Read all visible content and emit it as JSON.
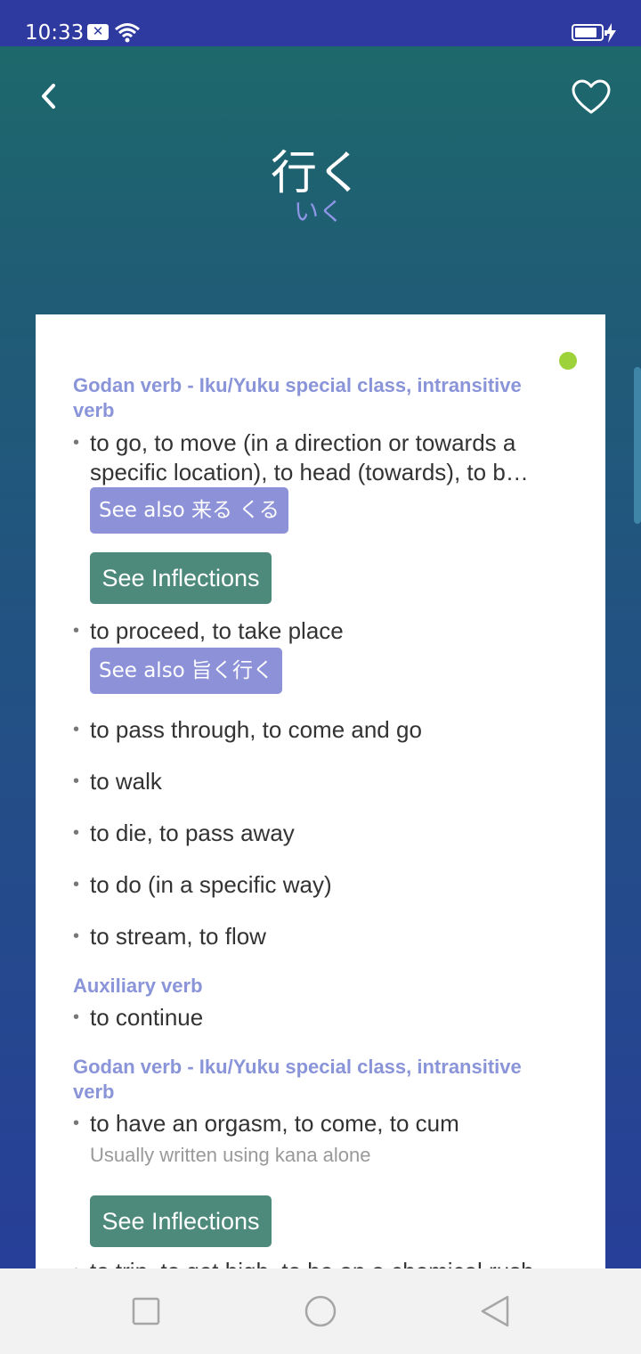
{
  "status_bar": {
    "time": "10:33",
    "icons": [
      "notification-x-icon",
      "wifi-icon",
      "battery-icon",
      "charging-bolt-icon"
    ]
  },
  "header": {
    "back_icon": "chevron-left-icon",
    "favorite_icon": "heart-outline-icon",
    "kanji": "行く",
    "reading": "いく"
  },
  "colors": {
    "accent_pos": "#8a94d8",
    "see_also_chip": "#8c91d8",
    "inflections_button": "#4e8a7c",
    "status_dot": "#9dd23a"
  },
  "entries": {
    "pos1": "Godan verb - Iku/Yuku special class, intransitive verb",
    "sense1": "to go, to move (in a direction or towards a specific location), to head (towards), to b…",
    "see_also1": "See also 来る くる",
    "inflections_label": "See Inflections",
    "sense2": "to proceed, to take place",
    "see_also2": "See also 旨く行く",
    "sense3": "to pass through, to come and go",
    "sense4": "to walk",
    "sense5": "to die, to pass away",
    "sense6": "to do (in a specific way)",
    "sense7": "to stream, to flow",
    "pos2": "Auxiliary verb",
    "sense8": "to continue",
    "pos3": "Godan verb - Iku/Yuku special class, intransitive verb",
    "sense9": "to have an orgasm, to come, to cum",
    "note9": "Usually written using kana alone",
    "inflections_label2": "See Inflections",
    "sense10_partial": "to trip, to get high, to be on a chemical rush"
  },
  "nav": {
    "icons": [
      "recent-apps-icon",
      "home-icon",
      "back-triangle-icon"
    ]
  }
}
